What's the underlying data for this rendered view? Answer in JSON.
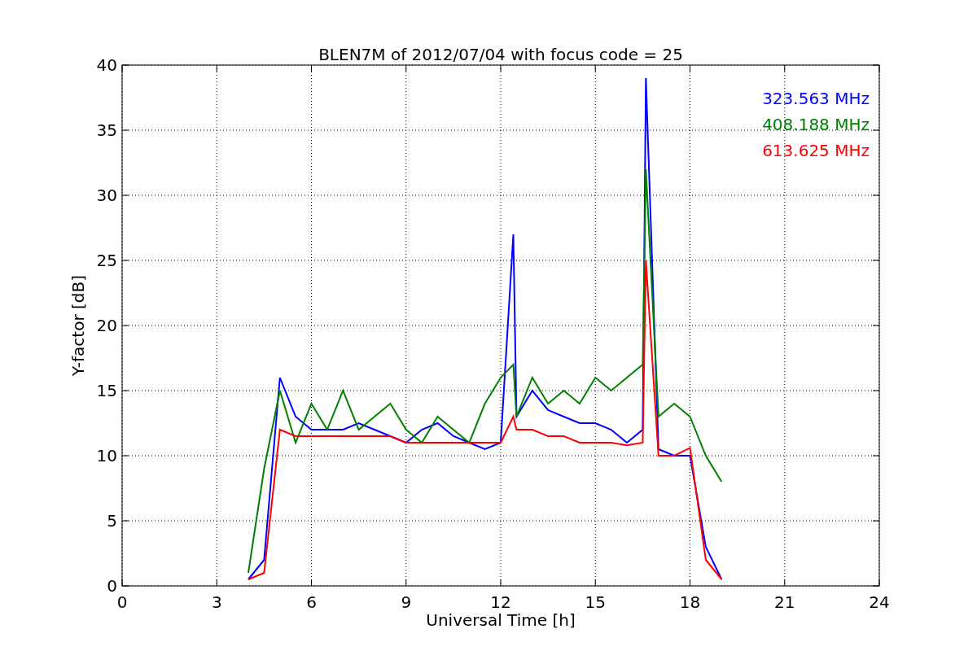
{
  "chart_data": {
    "type": "line",
    "title": "BLEN7M of 2012/07/04 with focus code = 25",
    "xlabel": "Universal Time [h]",
    "ylabel": "Y-factor [dB]",
    "x": [
      4,
      4.5,
      5,
      5.5,
      6,
      6.5,
      7,
      7.5,
      8,
      8.5,
      9,
      9.5,
      10,
      10.5,
      11,
      11.5,
      12,
      12.4,
      12.5,
      13,
      13.5,
      14,
      14.5,
      15,
      15.5,
      16,
      16.5,
      16.6,
      17,
      17.5,
      18,
      18.5,
      19
    ],
    "series": [
      {
        "name": "323.563 MHz",
        "color": "#0000ff",
        "values": [
          0.5,
          2,
          16,
          13,
          12,
          12,
          12,
          12.5,
          12,
          11.5,
          11,
          12,
          12.5,
          11.5,
          11,
          10.5,
          11,
          27,
          13,
          15,
          13.5,
          13,
          12.5,
          12.5,
          12,
          11,
          12,
          39,
          10.5,
          10,
          10,
          3,
          0.5
        ]
      },
      {
        "name": "408.188 MHz",
        "color": "#008000",
        "values": [
          1,
          9,
          15,
          11,
          14,
          12,
          15,
          12,
          13,
          14,
          12,
          11,
          13,
          12,
          11,
          14,
          16,
          17,
          13,
          16,
          14,
          15,
          14,
          16,
          15,
          16,
          17,
          32,
          13,
          14,
          13,
          10,
          8
        ]
      },
      {
        "name": "613.625 MHz",
        "color": "#ff0000",
        "values": [
          0.5,
          1,
          12,
          11.5,
          11.5,
          11.5,
          11.5,
          11.5,
          11.5,
          11.5,
          11,
          11,
          11,
          11,
          11,
          11,
          11,
          13,
          12,
          12,
          11.5,
          11.5,
          11,
          11,
          11,
          10.8,
          11,
          25,
          10,
          10,
          10.6,
          2,
          0.5
        ]
      }
    ],
    "grid": true,
    "xlim": [
      0,
      24
    ],
    "ylim": [
      0,
      40
    ],
    "xticks": [
      0,
      3,
      6,
      9,
      12,
      15,
      18,
      21,
      24
    ],
    "yticks": [
      0,
      5,
      10,
      15,
      20,
      25,
      30,
      35,
      40
    ]
  }
}
